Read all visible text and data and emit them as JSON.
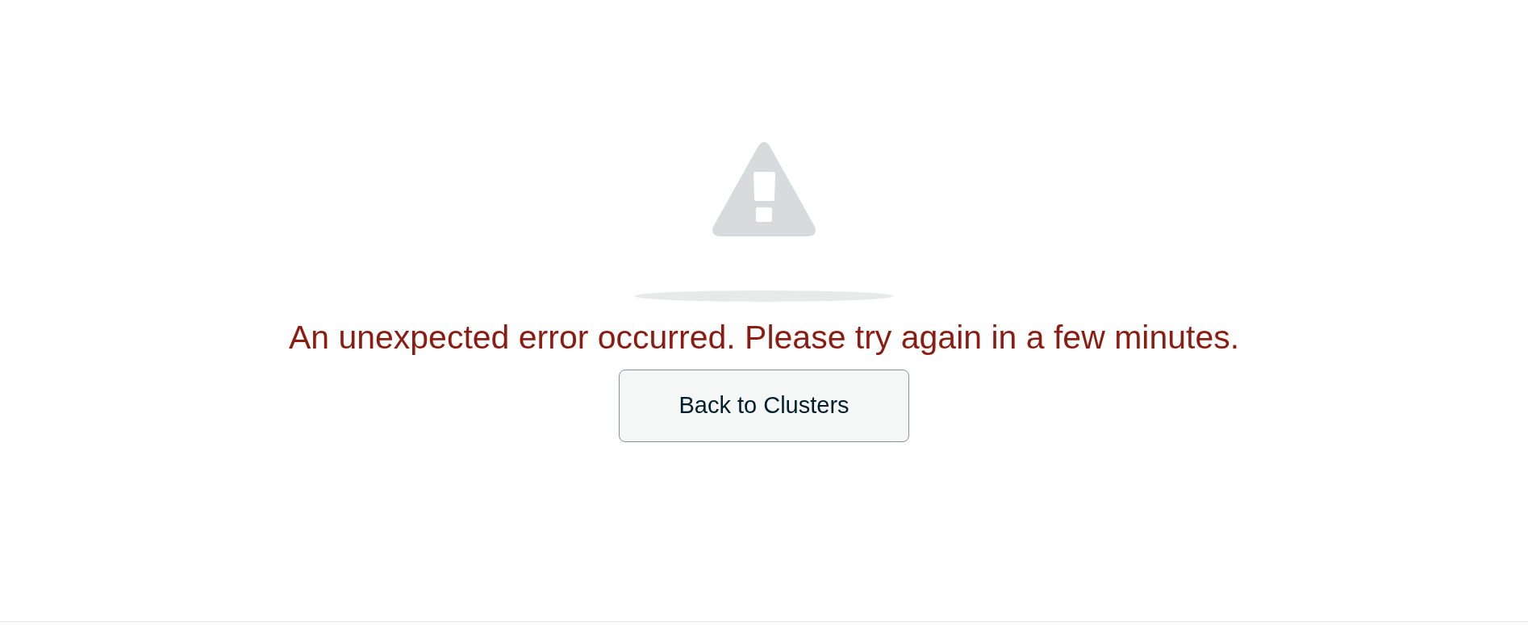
{
  "error": {
    "message": "An unexpected error occurred. Please try again in a few minutes."
  },
  "button": {
    "label": "Back to Clusters"
  }
}
